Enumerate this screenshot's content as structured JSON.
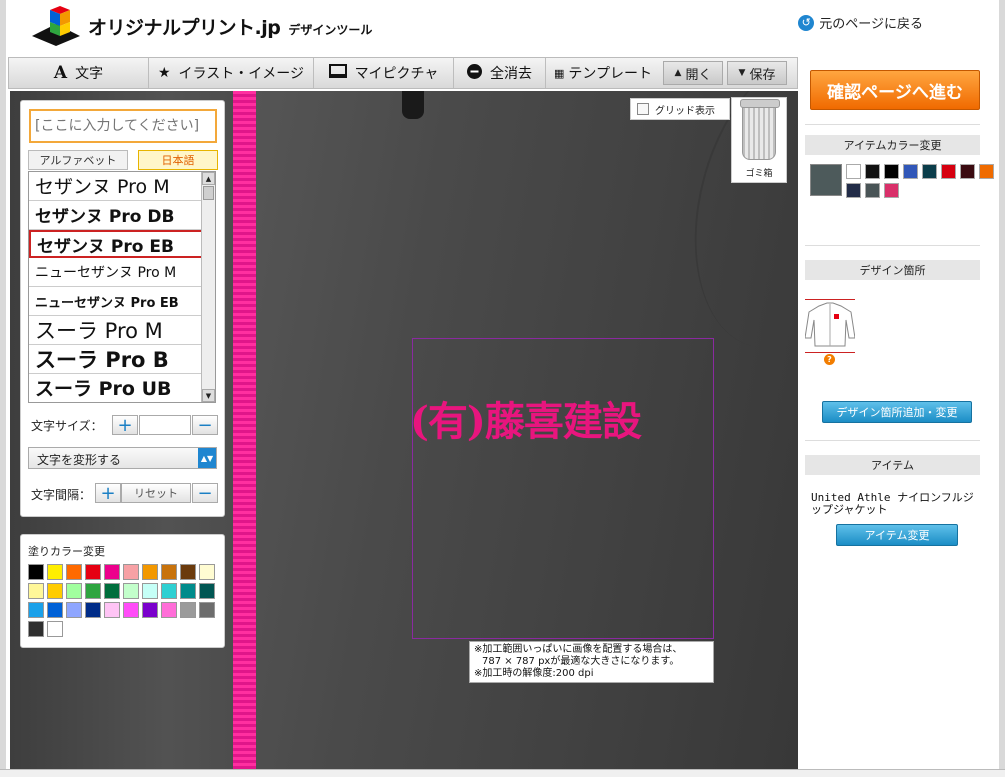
{
  "header": {
    "logo_text": "オリジナルプリント.jp",
    "logo_sub": "デザインツール",
    "back_link": "元のページに戻る"
  },
  "toolbar": {
    "text": "文字",
    "illust": "イラスト・イメージ",
    "mypicture": "マイピクチャ",
    "clear_all": "全消去",
    "template": "テンプレート",
    "open": "開く",
    "save": "保存"
  },
  "canvas": {
    "grid_label": "グリッド表示",
    "trash_label": "ゴミ箱",
    "design_text": "(有)藤喜建設",
    "note_line1": "※加工範囲いっぱいに画像を配置する場合は、",
    "note_line2": "787 × 787 pxが最適な大きさになります。",
    "note_line3": "※加工時の解像度:200 dpi"
  },
  "text_panel": {
    "input_placeholder": "[ここに入力してください]",
    "tab_alphabet": "アルファベット",
    "tab_japanese": "日本語",
    "fonts": [
      "セザンヌ Pro M",
      "セザンヌ Pro DB",
      "セザンヌ Pro EB",
      "ニューセザンヌ Pro M",
      "ニューセザンヌ Pro EB",
      "スーラ Pro M",
      "スーラ Pro B",
      "スーラ Pro UB"
    ],
    "selected_font": "セザンヌ Pro EB",
    "size_label": "文字サイズ：",
    "size_value": "",
    "transform_label": "文字を変形する",
    "spacing_label": "文字間隔：",
    "reset_label": "リセット"
  },
  "color_panel": {
    "title": "塗りカラー変更",
    "colors": [
      "#000000",
      "#ffee00",
      "#ff6a00",
      "#e60012",
      "#ec008c",
      "#f7a1a5",
      "#f39800",
      "#c8730c",
      "#6b3a0c",
      "#fffcd2",
      "#fff799",
      "#ffcc00",
      "#a1ff9e",
      "#2ea53f",
      "#006e3c",
      "#c3ffcb",
      "#c5fff7",
      "#2fd0d2",
      "#008b8b",
      "#005653",
      "#1ba1ea",
      "#0061d7",
      "#8fa6ff",
      "#002c88",
      "#ffc4f5",
      "#ff4cf8",
      "#7a00cc",
      "#ff6ed8",
      "#9b9b9b",
      "#6d6d6d",
      "#2f2f2f",
      "#ffffff"
    ]
  },
  "sidebar": {
    "confirm_button": "確認ページへ進む",
    "item_color_title": "アイテムカラー変更",
    "item_colors": [
      "#ffffff",
      "#111111",
      "#000000",
      "#3157b8",
      "#0b3d4a",
      "#d6000f",
      "#3a0a10",
      "#ef6b00",
      "#222c48",
      "#495456",
      "#d9306a"
    ],
    "selected_item_color": "#4d5a5b",
    "design_location_title": "デザイン箇所",
    "add_location_button": "デザイン箇所追加・変更",
    "item_title": "アイテム",
    "item_name": "United Athle ナイロンフルジップジャケット",
    "change_item_button": "アイテム変更"
  }
}
